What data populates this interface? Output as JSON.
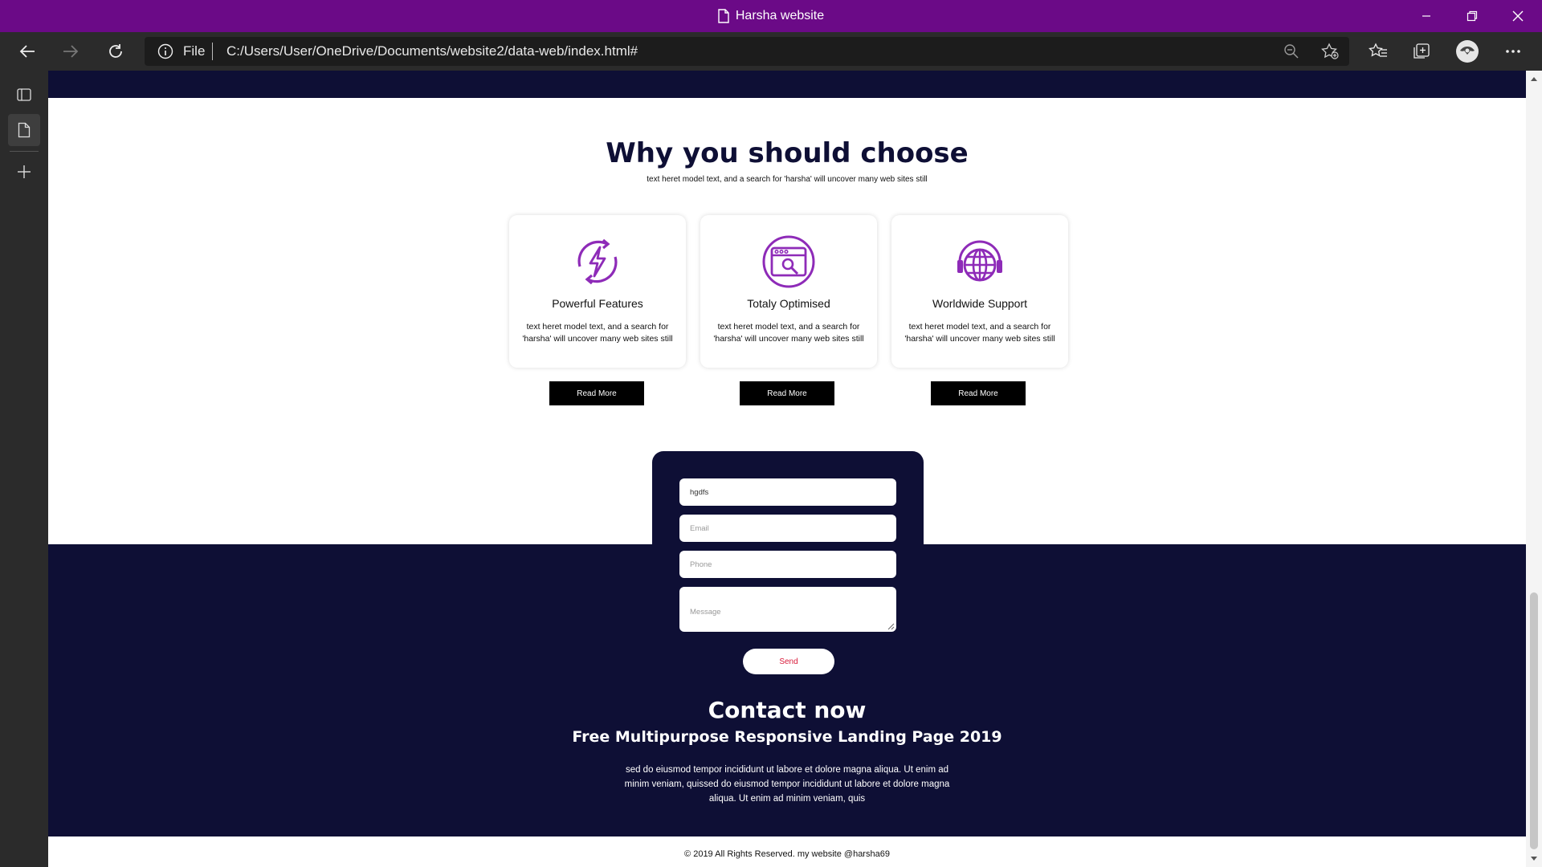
{
  "window": {
    "title": "Harsha website"
  },
  "toolbar": {
    "scheme": "File",
    "url": "C:/Users/User/OneDrive/Documents/website2/data-web/index.html#"
  },
  "why": {
    "title": "Why you should choose",
    "subtitle": "text heret model text, and a search for 'harsha' will uncover many web sites still"
  },
  "cards": [
    {
      "title": "Powerful Features",
      "text": "text heret model text, and a search for 'harsha' will uncover many web sites still",
      "icon": "lightning-refresh-icon",
      "button": "Read More"
    },
    {
      "title": "Totaly Optimised",
      "text": "text heret model text, and a search for 'harsha' will uncover many web sites still",
      "icon": "browser-search-icon",
      "button": "Read More"
    },
    {
      "title": "Worldwide Support",
      "text": "text heret model text, and a search for 'harsha' will uncover many web sites still",
      "icon": "globe-headset-icon",
      "button": "Read More"
    }
  ],
  "form": {
    "name_value": "hgdfs",
    "email_placeholder": "Email",
    "phone_placeholder": "Phone",
    "message_placeholder": "Message",
    "send_label": "Send"
  },
  "contact": {
    "title": "Contact now",
    "subtitle": "Free Multipurpose Responsive Landing Page 2019",
    "paragraph": "sed do eiusmod tempor incididunt ut labore et dolore magna aliqua. Ut enim ad minim veniam, quissed do eiusmod tempor incididunt ut labore et dolore magna aliqua. Ut enim ad minim veniam, quis"
  },
  "footer": {
    "copyright": "© 2019 All Rights Reserved. my website @harsha69"
  },
  "colors": {
    "titlebar": "#6b0a87",
    "navy": "#0e0f35",
    "icon_purple": "#8e2bb8",
    "send_text": "#d81b3a"
  }
}
